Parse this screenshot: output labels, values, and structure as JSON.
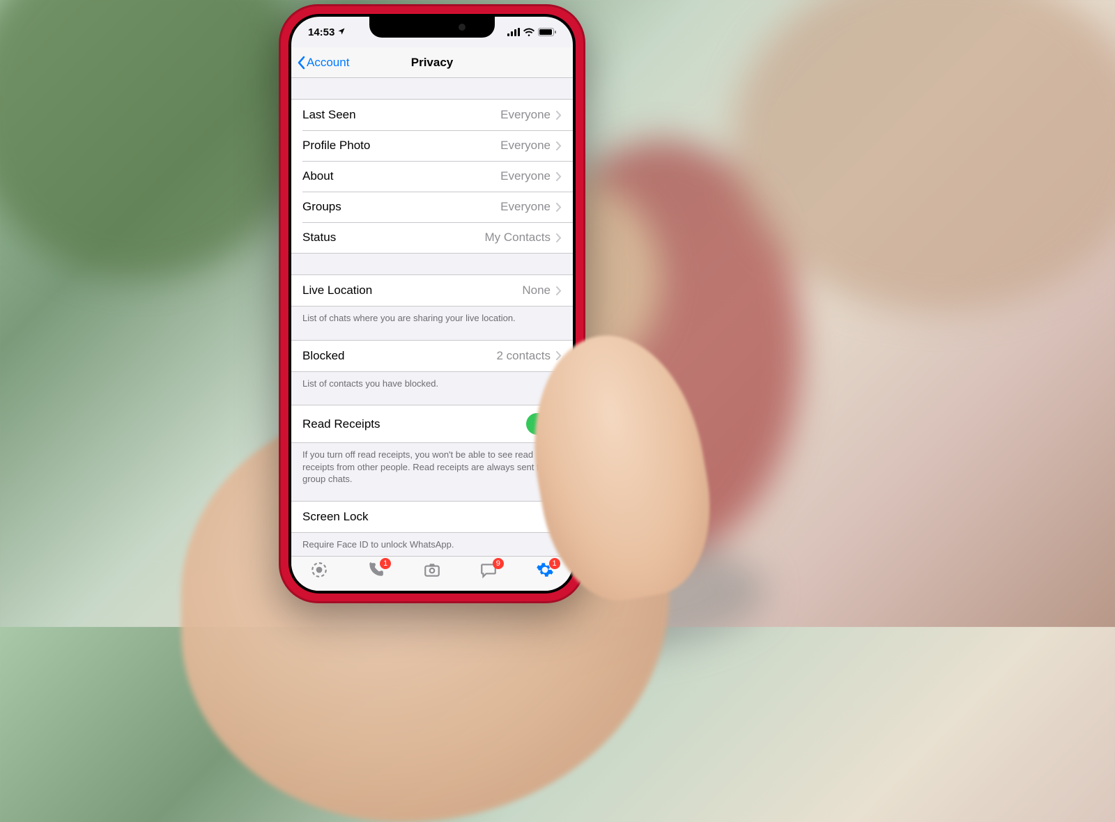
{
  "status_bar": {
    "time": "14:53",
    "location_icon": "location-arrow"
  },
  "navbar": {
    "back_label": "Account",
    "title": "Privacy"
  },
  "sections": {
    "visibility": [
      {
        "label": "Last Seen",
        "value": "Everyone"
      },
      {
        "label": "Profile Photo",
        "value": "Everyone"
      },
      {
        "label": "About",
        "value": "Everyone"
      },
      {
        "label": "Groups",
        "value": "Everyone"
      },
      {
        "label": "Status",
        "value": "My Contacts"
      }
    ],
    "live_location": {
      "label": "Live Location",
      "value": "None",
      "footer": "List of chats where you are sharing your live location."
    },
    "blocked": {
      "label": "Blocked",
      "value": "2 contacts",
      "footer": "List of contacts you have blocked."
    },
    "read_receipts": {
      "label": "Read Receipts",
      "enabled": true,
      "footer": "If you turn off read receipts, you won't be able to see read receipts from other people. Read receipts are always sent for group chats."
    },
    "screen_lock": {
      "label": "Screen Lock",
      "footer": "Require Face ID to unlock WhatsApp."
    }
  },
  "tabbar": {
    "items": [
      {
        "name": "status",
        "badge": null
      },
      {
        "name": "calls",
        "badge": "1"
      },
      {
        "name": "camera",
        "badge": null
      },
      {
        "name": "chats",
        "badge": "9"
      },
      {
        "name": "settings",
        "badge": "1",
        "active": true
      }
    ]
  }
}
